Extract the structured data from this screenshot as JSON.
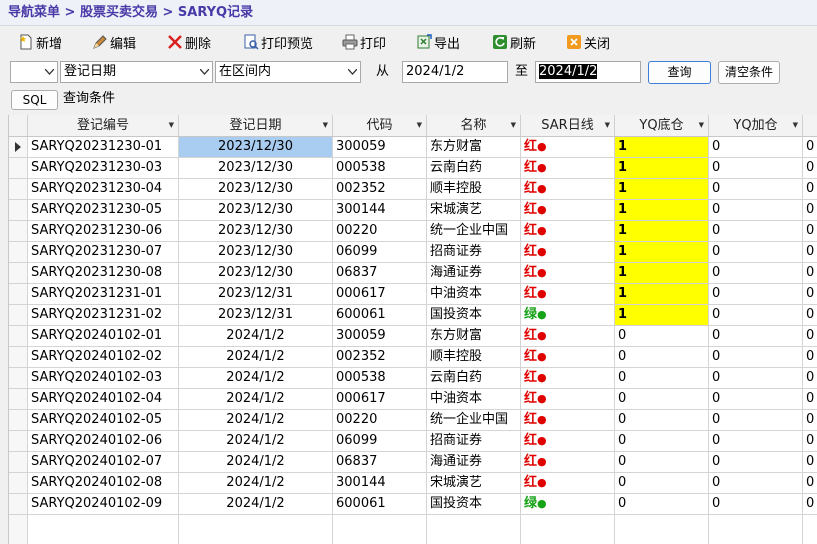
{
  "breadcrumb": "导航菜单 > 股票买卖交易 > SARYQ记录",
  "toolbar": {
    "new": "新增",
    "edit": "编辑",
    "delete": "删除",
    "print_preview": "打印预览",
    "print": "打印",
    "export": "导出",
    "refresh": "刷新",
    "close": "关闭"
  },
  "filter": {
    "logic": "",
    "field": "登记日期",
    "operator": "在区间内",
    "from_label": "从",
    "from_value": "2024/1/2",
    "to_label": "至",
    "to_value": "2024/1/2",
    "query_button": "查询",
    "clear_button": "清空条件"
  },
  "sql_bar": {
    "sql_button": "SQL",
    "condition_label": "查询条件"
  },
  "colors": {
    "selected_row": "#a8cdf0",
    "yq_highlight": "#ffff00",
    "red_signal": "#e00000",
    "green_signal": "#17a317",
    "breadcrumb_text": "#4a3aa8"
  },
  "table": {
    "columns": [
      "登记编号",
      "登记日期",
      "代码",
      "名称",
      "SAR日线",
      "YQ底仓",
      "YQ加仓"
    ],
    "rows": [
      {
        "id": "SARYQ20231230-01",
        "date": "2023/12/30",
        "code": "300059",
        "name": "东方财富",
        "sar": "红",
        "sar_dot": "●",
        "yq_base": "1",
        "yq_add": "0",
        "extra": "0"
      },
      {
        "id": "SARYQ20231230-03",
        "date": "2023/12/30",
        "code": "000538",
        "name": "云南白药",
        "sar": "红",
        "sar_dot": "●",
        "yq_base": "1",
        "yq_add": "0",
        "extra": "0"
      },
      {
        "id": "SARYQ20231230-04",
        "date": "2023/12/30",
        "code": "002352",
        "name": "顺丰控股",
        "sar": "红",
        "sar_dot": "●",
        "yq_base": "1",
        "yq_add": "0",
        "extra": "0"
      },
      {
        "id": "SARYQ20231230-05",
        "date": "2023/12/30",
        "code": "300144",
        "name": "宋城演艺",
        "sar": "红",
        "sar_dot": "●",
        "yq_base": "1",
        "yq_add": "0",
        "extra": "0"
      },
      {
        "id": "SARYQ20231230-06",
        "date": "2023/12/30",
        "code": "00220",
        "name": "统一企业中国",
        "sar": "红",
        "sar_dot": "●",
        "yq_base": "1",
        "yq_add": "0",
        "extra": "0"
      },
      {
        "id": "SARYQ20231230-07",
        "date": "2023/12/30",
        "code": "06099",
        "name": "招商证券",
        "sar": "红",
        "sar_dot": "●",
        "yq_base": "1",
        "yq_add": "0",
        "extra": "0"
      },
      {
        "id": "SARYQ20231230-08",
        "date": "2023/12/30",
        "code": "06837",
        "name": "海通证券",
        "sar": "红",
        "sar_dot": "●",
        "yq_base": "1",
        "yq_add": "0",
        "extra": "0"
      },
      {
        "id": "SARYQ20231231-01",
        "date": "2023/12/31",
        "code": "000617",
        "name": "中油资本",
        "sar": "红",
        "sar_dot": "●",
        "yq_base": "1",
        "yq_add": "0",
        "extra": "0"
      },
      {
        "id": "SARYQ20231231-02",
        "date": "2023/12/31",
        "code": "600061",
        "name": "国投资本",
        "sar": "绿",
        "sar_dot": "●",
        "yq_base": "1",
        "yq_add": "0",
        "extra": "0"
      },
      {
        "id": "SARYQ20240102-01",
        "date": "2024/1/2",
        "code": "300059",
        "name": "东方财富",
        "sar": "红",
        "sar_dot": "●",
        "yq_base": "0",
        "yq_add": "0",
        "extra": "0"
      },
      {
        "id": "SARYQ20240102-02",
        "date": "2024/1/2",
        "code": "002352",
        "name": "顺丰控股",
        "sar": "红",
        "sar_dot": "●",
        "yq_base": "0",
        "yq_add": "0",
        "extra": "0"
      },
      {
        "id": "SARYQ20240102-03",
        "date": "2024/1/2",
        "code": "000538",
        "name": "云南白药",
        "sar": "红",
        "sar_dot": "●",
        "yq_base": "0",
        "yq_add": "0",
        "extra": "0"
      },
      {
        "id": "SARYQ20240102-04",
        "date": "2024/1/2",
        "code": "000617",
        "name": "中油资本",
        "sar": "红",
        "sar_dot": "●",
        "yq_base": "0",
        "yq_add": "0",
        "extra": "0"
      },
      {
        "id": "SARYQ20240102-05",
        "date": "2024/1/2",
        "code": "00220",
        "name": "统一企业中国",
        "sar": "红",
        "sar_dot": "●",
        "yq_base": "0",
        "yq_add": "0",
        "extra": "0"
      },
      {
        "id": "SARYQ20240102-06",
        "date": "2024/1/2",
        "code": "06099",
        "name": "招商证券",
        "sar": "红",
        "sar_dot": "●",
        "yq_base": "0",
        "yq_add": "0",
        "extra": "0"
      },
      {
        "id": "SARYQ20240102-07",
        "date": "2024/1/2",
        "code": "06837",
        "name": "海通证券",
        "sar": "红",
        "sar_dot": "●",
        "yq_base": "0",
        "yq_add": "0",
        "extra": "0"
      },
      {
        "id": "SARYQ20240102-08",
        "date": "2024/1/2",
        "code": "300144",
        "name": "宋城演艺",
        "sar": "红",
        "sar_dot": "●",
        "yq_base": "0",
        "yq_add": "0",
        "extra": "0"
      },
      {
        "id": "SARYQ20240102-09",
        "date": "2024/1/2",
        "code": "600061",
        "name": "国投资本",
        "sar": "绿",
        "sar_dot": "●",
        "yq_base": "0",
        "yq_add": "0",
        "extra": "0"
      }
    ],
    "selected_index": 0
  }
}
